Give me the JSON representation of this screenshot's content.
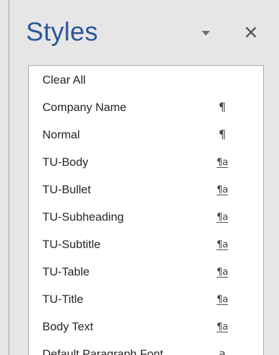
{
  "pane": {
    "title": "Styles",
    "menu_icon": "dropdown-triangle-icon",
    "close_icon": "close-x-icon"
  },
  "styles": [
    {
      "name": "Clear All",
      "type_glyph": ""
    },
    {
      "name": "Company Name",
      "type_glyph": "¶"
    },
    {
      "name": "Normal",
      "type_glyph": "¶"
    },
    {
      "name": "TU-Body",
      "type_glyph": "¶a"
    },
    {
      "name": "TU-Bullet",
      "type_glyph": "¶a"
    },
    {
      "name": "TU-Subheading",
      "type_glyph": "¶a"
    },
    {
      "name": "TU-Subtitle",
      "type_glyph": "¶a"
    },
    {
      "name": "TU-Table",
      "type_glyph": "¶a"
    },
    {
      "name": "TU-Title",
      "type_glyph": "¶a"
    },
    {
      "name": "Body Text",
      "type_glyph": "¶a"
    },
    {
      "name": "Default Paragraph Font",
      "type_glyph": "a"
    }
  ],
  "colors": {
    "title": "#2b579a",
    "pane_background": "#e6e6e6",
    "list_background": "#ffffff"
  }
}
